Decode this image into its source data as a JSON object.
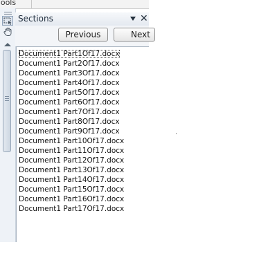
{
  "top_strip": {
    "tools_label": "Tools"
  },
  "left_bar": {
    "icons": [
      "select-icon",
      "hand-icon"
    ],
    "scroll_up_icon": "triangle-up-icon"
  },
  "panel": {
    "title": "Sections",
    "dropdown_icon": "triangle-down-icon",
    "close_label": "✕",
    "buttons": {
      "previous": "Previous",
      "next": "Next"
    }
  },
  "sections": [
    "Document1 Part1Of17.docx",
    "Document1 Part2Of17.docx",
    "Document1 Part3Of17.docx",
    "Document1 Part4Of17.docx",
    "Document1 Part5Of17.docx",
    "Document1 Part6Of17.docx",
    "Document1 Part7Of17.docx",
    "Document1 Part8Of17.docx",
    "Document1 Part9Of17.docx",
    "Document1 Part10Of17.docx",
    "Document1 Part11Of17.docx",
    "Document1 Part12Of17.docx",
    "Document1 Part13Of17.docx",
    "Document1 Part14Of17.docx",
    "Document1 Part15Of17.docx",
    "Document1 Part16Of17.docx",
    "Document1 Part17Of17.docx"
  ]
}
